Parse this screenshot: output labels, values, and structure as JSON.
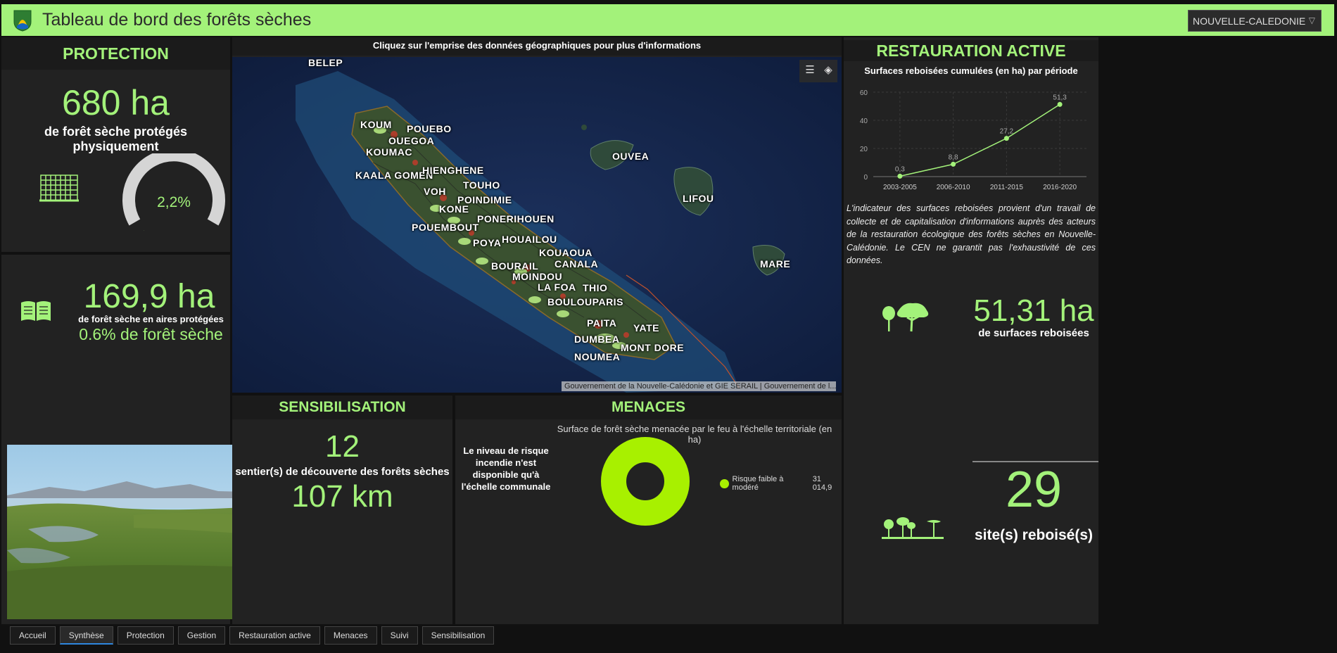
{
  "header": {
    "title": "Tableau de bord des forêts sèches",
    "region": "NOUVELLE-CALEDONIE"
  },
  "protection": {
    "title": "PROTECTION",
    "ha_value": "680 ha",
    "ha_caption": "de forêt sèche protégés physiquement",
    "gauge_value": "2,2%",
    "gauge_fraction": 0.022,
    "areas_value": "169,9 ha",
    "areas_caption": "de forêt sèche en aires protégées",
    "areas_pct": "0.6% de forêt sèche"
  },
  "map": {
    "instruction": "Cliquez sur l'emprise des données géographiques pour plus d'informations",
    "attribution": "Gouvernement de la Nouvelle-Calédonie et GIE SERAIL | Gouvernement de l...",
    "labels": [
      "BELEP",
      "KOUM",
      "POUEBO",
      "OUEGOA",
      "KOUMAC",
      "KAALA GOMEN",
      "HIENGHENE",
      "TOUHO",
      "VOH",
      "POINDIMIE",
      "KONE",
      "PONERIHOUEN",
      "POUEMBOUT",
      "HOUAILOU",
      "POYA",
      "KOUAOUA",
      "BOURAIL",
      "CANALA",
      "MOINDOU",
      "LA FOA",
      "THIO",
      "BOULOUPARIS",
      "PAITA",
      "YATE",
      "DUMBEA",
      "MONT DORE",
      "NOUMEA",
      "OUVEA",
      "LIFOU",
      "MARE"
    ]
  },
  "restoration": {
    "title": "RESTAURATION ACTIVE",
    "chart_title": "Surfaces reboisées cumulées (en ha) par période",
    "description": "L'indicateur des surfaces reboisées provient d'un travail de collecte et de capitalisation d'informations auprès des acteurs de la restauration écologique des forêts sèches en Nouvelle-Calédonie. Le CEN ne garantit pas l'exhaustivité de ces données.",
    "ha_value": "51,31 ha",
    "ha_caption": "de surfaces reboisées",
    "sites_value": "29",
    "sites_caption": "site(s) reboisé(s)"
  },
  "chart_data": {
    "type": "line",
    "categories": [
      "2003-2005",
      "2006-2010",
      "2011-2015",
      "2016-2020"
    ],
    "values": [
      0.3,
      8.8,
      27.2,
      51.3
    ],
    "value_labels": [
      "0,3",
      "8,8",
      "27,2",
      "51,3"
    ],
    "yticks": [
      0,
      20,
      40,
      60
    ],
    "ylim": [
      0,
      60
    ],
    "grid": true,
    "color": "#a3f27a"
  },
  "awareness": {
    "title": "SENSIBILISATION",
    "count": "12",
    "caption": "sentier(s) de découverte des forêts sèches",
    "km": "107 km"
  },
  "threats": {
    "title": "MENACES",
    "chart_title": "Surface de forêt sèche menacée par le feu à l'échelle territoriale (en ha)",
    "note": "Le niveau de risque incendie n'est disponible qu'à l'échelle communale",
    "legend_label": "Risque faible à modéré",
    "legend_value": "31 014,9",
    "donut_color": "#a8f000"
  },
  "tabs": [
    "Accueil",
    "Synthèse",
    "Protection",
    "Gestion",
    "Restauration active",
    "Menaces",
    "Suivi",
    "Sensibilisation"
  ],
  "active_tab": "Synthèse",
  "colors": {
    "accent": "#a3f27a",
    "panel": "#222222",
    "header": "#a3f27a"
  }
}
